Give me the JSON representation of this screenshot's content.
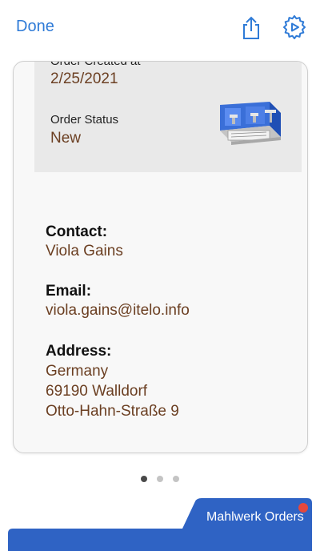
{
  "nav": {
    "done_label": "Done",
    "share_icon": "share-icon",
    "settings_icon": "settings-gear-icon",
    "accent_color": "#2f7bd7"
  },
  "card": {
    "created_label": "Order Created at",
    "created_value": "2/25/2021",
    "status_label": "Order Status",
    "status_value": "New",
    "image": "espresso-machine-image",
    "contact_label": "Contact:",
    "contact_value": "Viola Gains",
    "email_label": "Email:",
    "email_value": "viola.gains@itelo.info",
    "address_label": "Address:",
    "address_lines": [
      "Germany",
      "69190 Walldorf",
      "Otto-Hahn-Straße 9"
    ],
    "value_color": "#6b3f22"
  },
  "pager": {
    "count": 3,
    "active_index": 0
  },
  "bottom_tab": {
    "label": "Mahlwerk Orders",
    "color": "#2f63c4",
    "badge_color": "#e5483d"
  }
}
